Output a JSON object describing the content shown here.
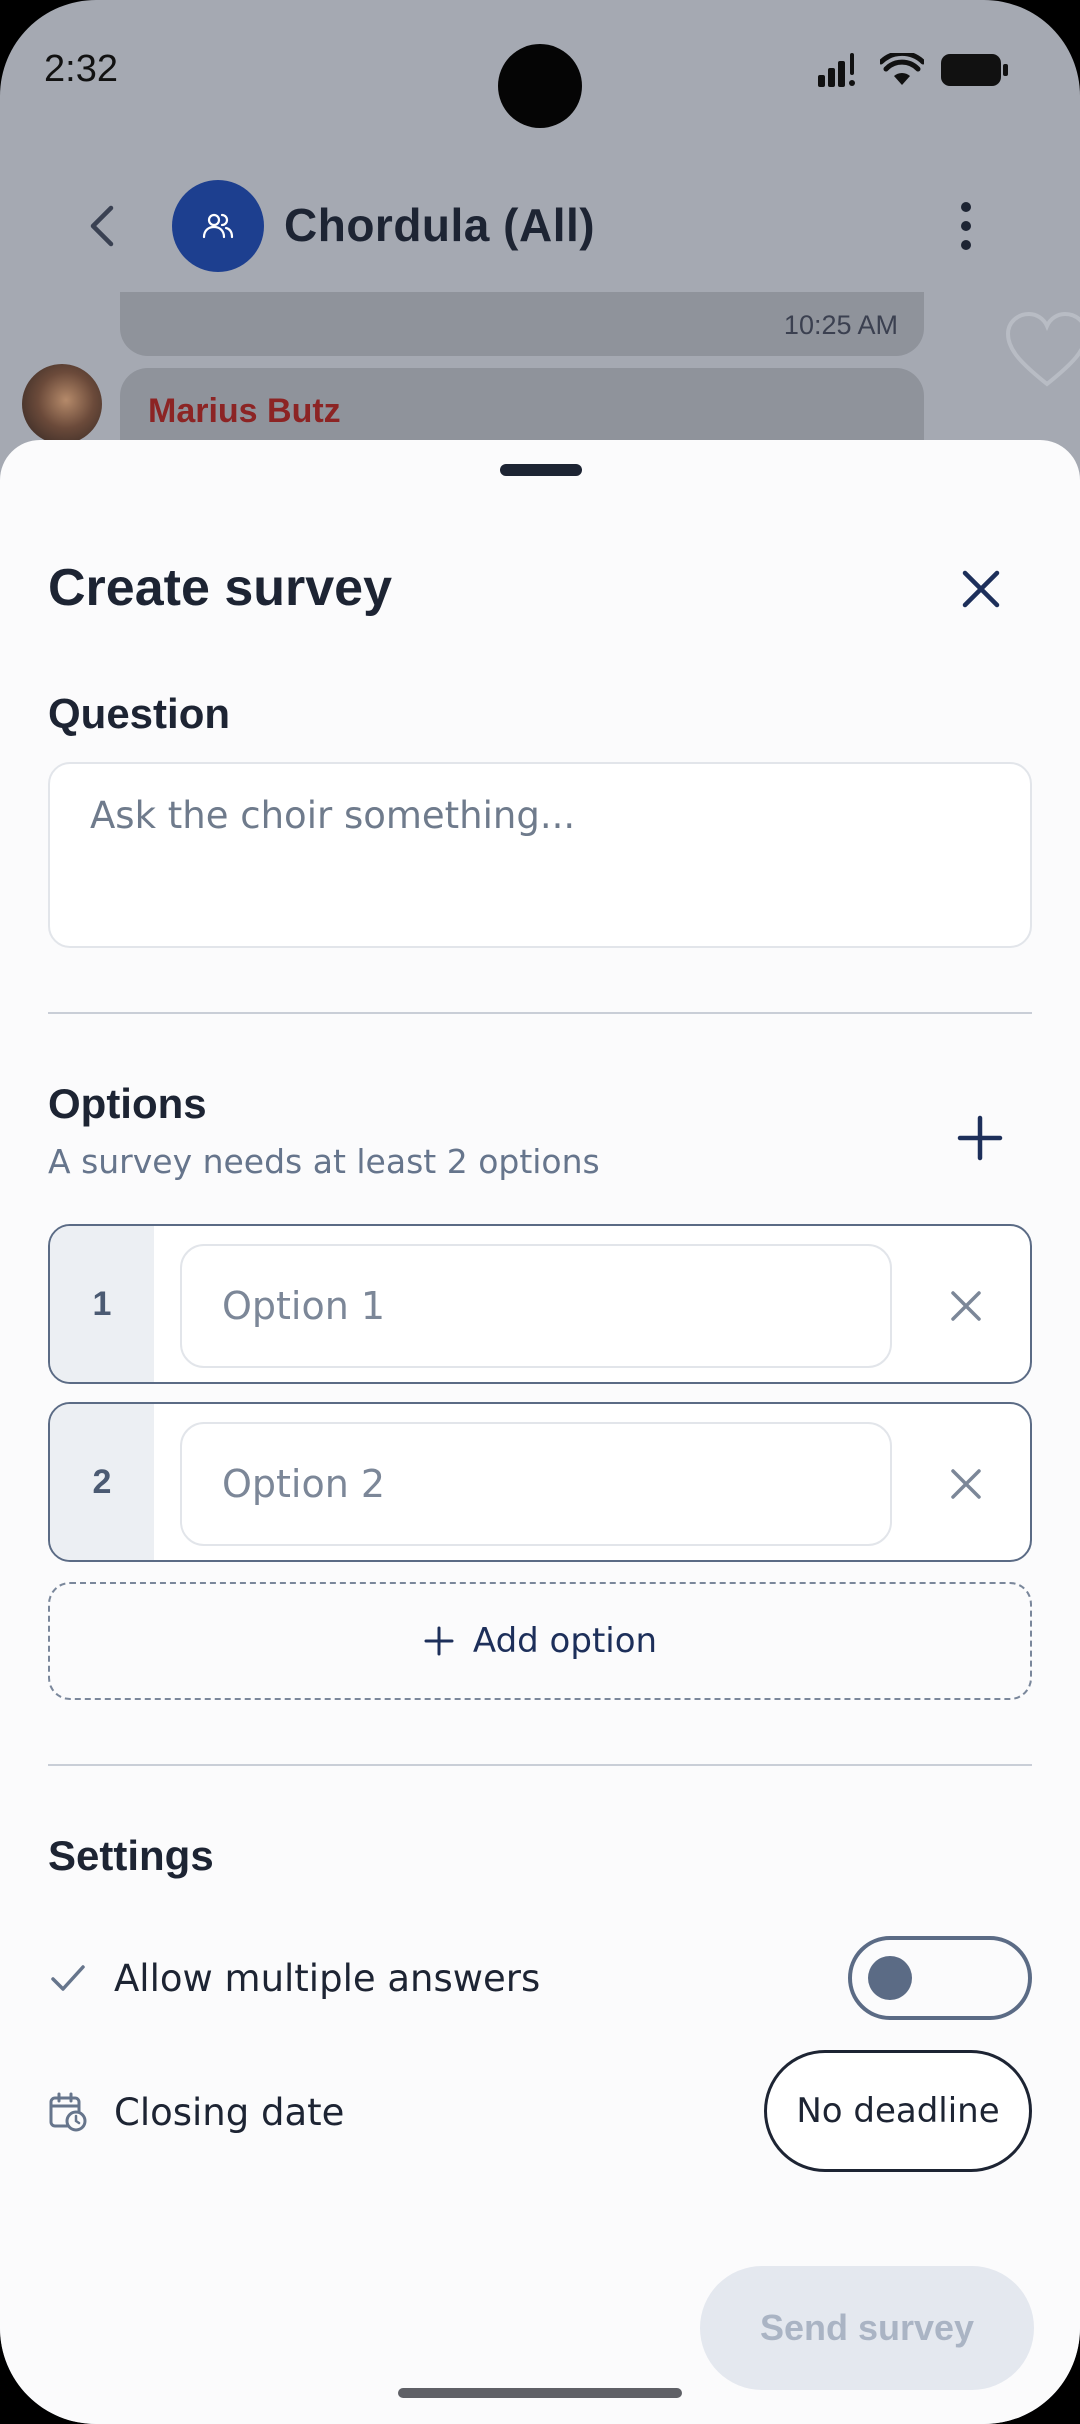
{
  "status_bar": {
    "time": "2:32"
  },
  "chat_header": {
    "title": "Chordula (All)"
  },
  "messages": [
    {
      "time": "10:25 AM"
    },
    {
      "sender": "Marius Butz"
    }
  ],
  "sheet": {
    "title": "Create survey",
    "question": {
      "label": "Question",
      "placeholder": "Ask the choir something..."
    },
    "options": {
      "label": "Options",
      "hint": "A survey needs at least 2 options",
      "items": [
        {
          "number": "1",
          "placeholder": "Option 1"
        },
        {
          "number": "2",
          "placeholder": "Option 2"
        }
      ],
      "add_label": "Add option"
    },
    "settings": {
      "label": "Settings",
      "multiple_answers_label": "Allow multiple answers",
      "multiple_answers_enabled": false,
      "closing_date_label": "Closing date",
      "closing_date_value": "No deadline"
    },
    "send_label": "Send survey"
  },
  "colors": {
    "accent": "#1d3f8f",
    "text_dark": "#1d2433",
    "sender_name": "#8c2424",
    "send_disabled": "#e4e8ef"
  }
}
